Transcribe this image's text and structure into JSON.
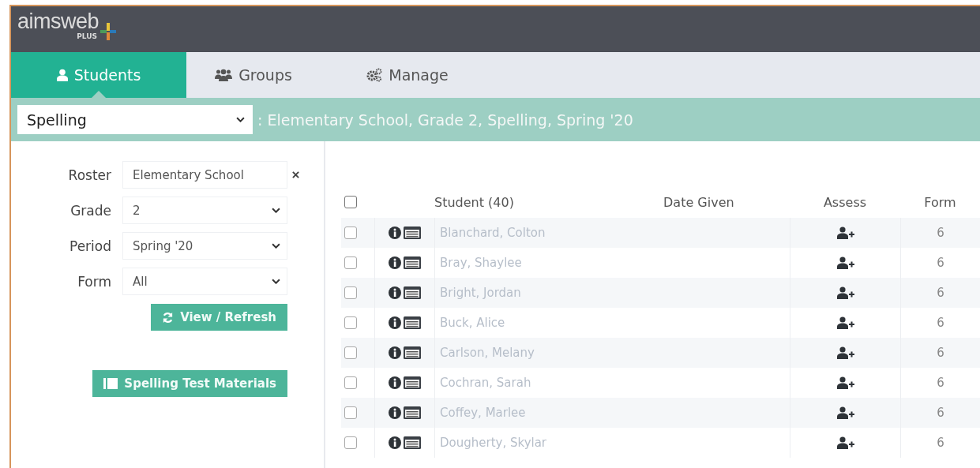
{
  "header": {
    "logo": "aimsweb",
    "logo_sub": "PLUS"
  },
  "tabs": [
    {
      "label": "Students",
      "selected": true
    },
    {
      "label": "Groups",
      "selected": false
    },
    {
      "label": "Manage",
      "selected": false
    }
  ],
  "measure_bar": {
    "measure": "Spelling",
    "context": ": Elementary School, Grade 2, Spelling, Spring '20"
  },
  "filters": [
    {
      "label": "Roster",
      "value": "Elementary School",
      "kind": "text"
    },
    {
      "label": "Grade",
      "value": "2",
      "kind": "select"
    },
    {
      "label": "Period",
      "value": "Spring '20",
      "kind": "select"
    },
    {
      "label": "Form",
      "value": "All",
      "kind": "select"
    }
  ],
  "refresh_button": "View / Refresh",
  "materials_button": "Spelling Test Materials",
  "table": {
    "select_all": false,
    "columns": [
      "Student (40)",
      "Date Given",
      "Assess",
      "Form"
    ],
    "rows": [
      {
        "checked": false,
        "student": "Blanchard, Colton",
        "form": "6"
      },
      {
        "checked": false,
        "student": "Bray, Shaylee",
        "form": "6"
      },
      {
        "checked": false,
        "student": "Bright, Jordan",
        "form": "6"
      },
      {
        "checked": false,
        "student": "Buck, Alice",
        "form": "6"
      },
      {
        "checked": false,
        "student": "Carlson, Melany",
        "form": "6"
      },
      {
        "checked": false,
        "student": "Cochran, Sarah",
        "form": "6"
      },
      {
        "checked": false,
        "student": "Coffey, Marlee",
        "form": "6"
      },
      {
        "checked": false,
        "student": "Dougherty, Skylar",
        "form": "6"
      }
    ]
  }
}
